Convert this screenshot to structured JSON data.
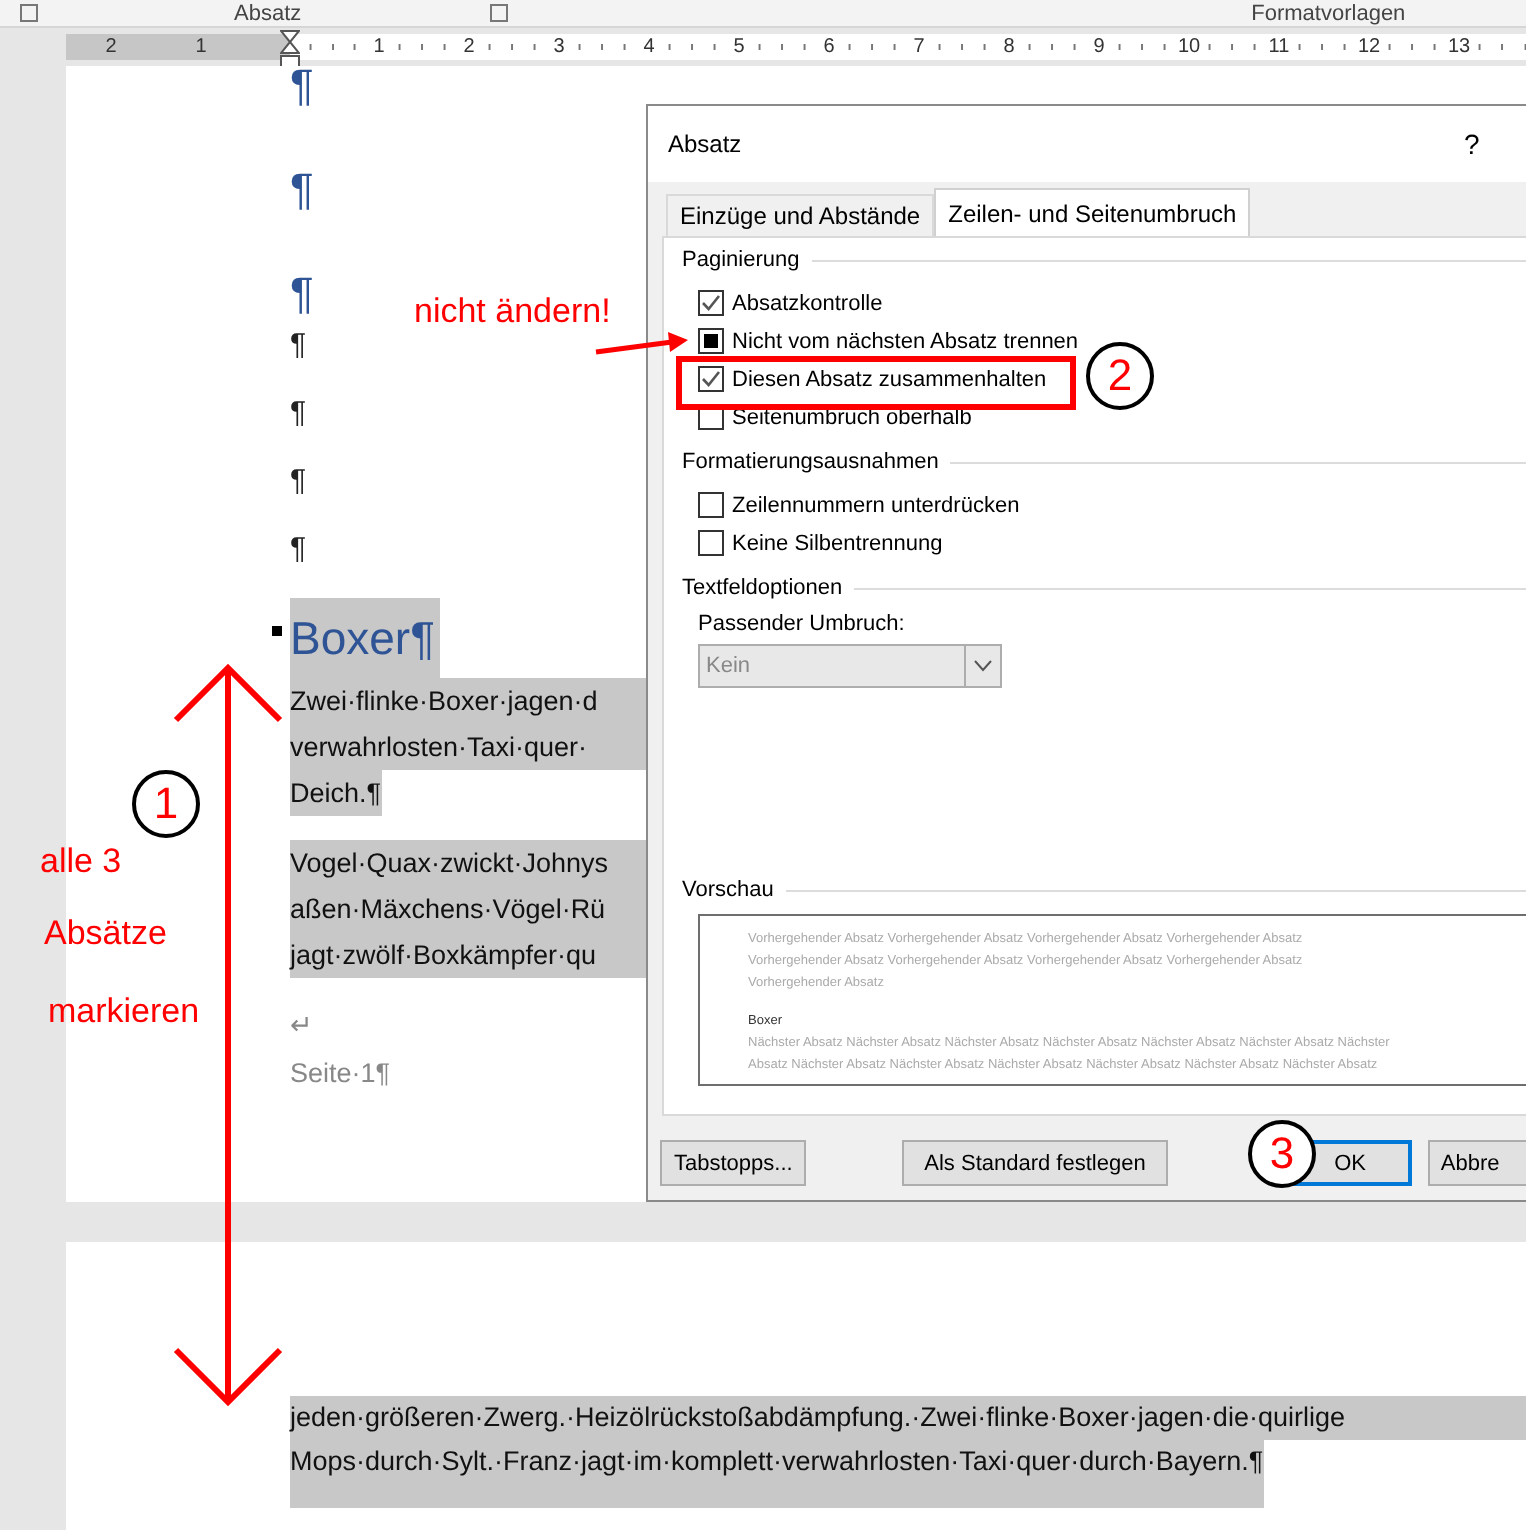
{
  "ribbon": {
    "groups": [
      {
        "label": "Absatz"
      },
      {
        "label": "Formatvorlagen"
      }
    ]
  },
  "ruler": {
    "left_numbers": [
      "2",
      "1"
    ],
    "right_numbers": [
      "1",
      "2",
      "3",
      "4",
      "5",
      "6",
      "7",
      "8",
      "9",
      "10",
      "11",
      "12",
      "13"
    ]
  },
  "page1": {
    "empty_paragraphs": [
      {
        "kind": "heading",
        "mark": "¶"
      },
      {
        "kind": "heading",
        "mark": "¶"
      },
      {
        "kind": "heading",
        "mark": "¶"
      },
      {
        "kind": "body",
        "mark": "¶"
      },
      {
        "kind": "body",
        "mark": "¶"
      },
      {
        "kind": "body",
        "mark": "¶"
      },
      {
        "kind": "body",
        "mark": "¶"
      }
    ],
    "heading": {
      "text": "Boxer¶",
      "selected": true
    },
    "paragraphs": [
      {
        "selected": true,
        "lines": [
          "Zwei·flinke·Boxer·jagen·d",
          "verwahrlosten·Taxi·quer·",
          "Deich.¶"
        ]
      },
      {
        "selected": true,
        "lines": [
          "Vogel·Quax·zwickt·Johnys",
          "aßen·Mäxchens·Vögel·Rü",
          "jagt·zwölf·Boxkämpfer·qu"
        ]
      }
    ],
    "line_break": "↵",
    "footer": "Seite·1¶"
  },
  "page2": {
    "selected": true,
    "lines": [
      "jeden·größeren·Zwerg.·Heizölrückstoßabdämpfung.·Zwei·flinke·Boxer·jagen·die·quirlige",
      "Mops·durch·Sylt.·Franz·jagt·im·komplett·verwahrlosten·Taxi·quer·durch·Bayern.¶"
    ]
  },
  "dialog": {
    "title": "Absatz",
    "help": "?",
    "tabs": [
      {
        "label": "Einzüge und Abstände",
        "selected": false
      },
      {
        "label": "Zeilen- und Seitenumbruch",
        "selected": true
      }
    ],
    "groups": [
      {
        "title": "Paginierung",
        "options": [
          {
            "label": "Absatzkontrolle",
            "checked": true,
            "mixed": false
          },
          {
            "label": "Nicht vom nächsten Absatz trennen",
            "checked": false,
            "mixed": true
          },
          {
            "label": "Diesen Absatz zusammenhalten",
            "checked": true,
            "mixed": false
          },
          {
            "label": "Seitenumbruch oberhalb",
            "checked": false,
            "mixed": false
          }
        ]
      },
      {
        "title": "Formatierungsausnahmen",
        "options": [
          {
            "label": "Zeilennummern unterdrücken",
            "checked": false,
            "mixed": false
          },
          {
            "label": "Keine Silbentrennung",
            "checked": false,
            "mixed": false
          }
        ]
      }
    ],
    "textbox_options": {
      "title": "Textfeldoptionen",
      "label": "Passender Umbruch:",
      "value": "Kein",
      "disabled": true
    },
    "preview": {
      "title": "Vorschau",
      "previous_lines": [
        "Vorhergehender Absatz Vorhergehender Absatz Vorhergehender Absatz Vorhergehender Absatz",
        "Vorhergehender Absatz Vorhergehender Absatz Vorhergehender Absatz Vorhergehender Absatz",
        "Vorhergehender Absatz"
      ],
      "current": "Boxer",
      "next_lines": [
        "Nächster Absatz Nächster Absatz Nächster Absatz Nächster Absatz Nächster Absatz Nächster Absatz Nächster",
        "Absatz Nächster Absatz Nächster Absatz Nächster Absatz Nächster Absatz Nächster Absatz Nächster Absatz"
      ]
    },
    "buttons": [
      {
        "label": "Tabstopps...",
        "focused": false
      },
      {
        "label": "Als Standard festlegen",
        "focused": false
      },
      {
        "label": "OK",
        "focused": true
      },
      {
        "label": "Abbre",
        "focused": false
      }
    ]
  },
  "annotations": {
    "steps": [
      "1",
      "2",
      "3"
    ],
    "labels": [
      "nicht ändern!",
      "alle 3",
      "Absätze",
      "markieren"
    ]
  }
}
